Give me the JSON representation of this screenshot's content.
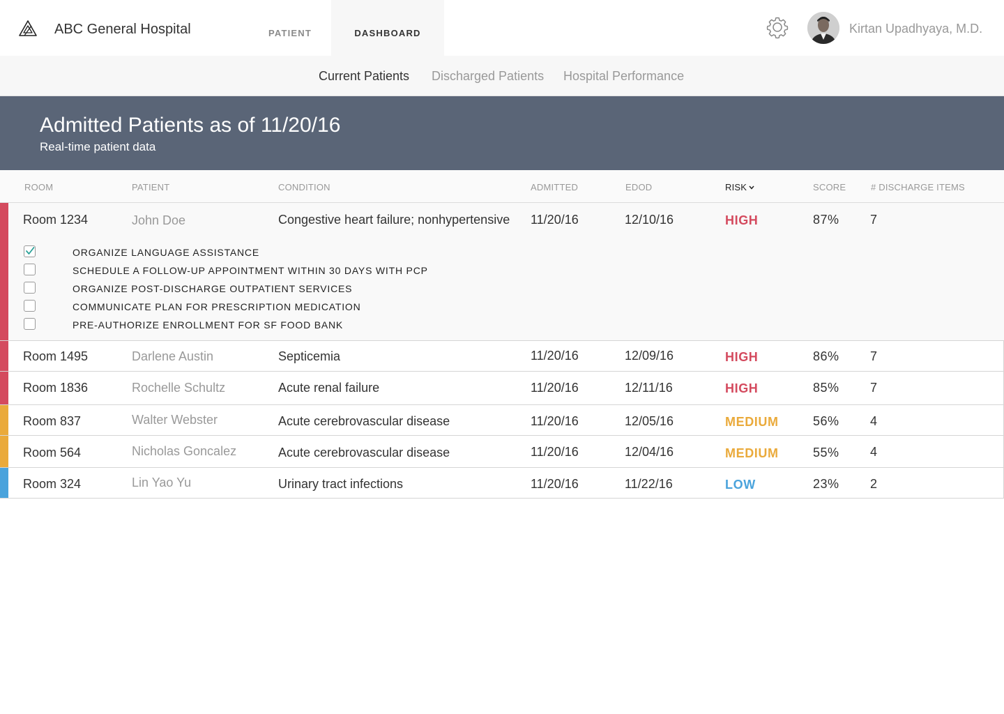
{
  "header": {
    "app_title": "ABC General Hospital",
    "logo_icon": "triangle-logo-icon",
    "tabs": [
      {
        "label": "PATIENT",
        "active": false
      },
      {
        "label": "DASHBOARD",
        "active": true
      }
    ],
    "settings_icon": "gear-icon",
    "user_name": "Kirtan Upadhyaya, M.D."
  },
  "subnav": {
    "tabs": [
      {
        "label": "Current Patients",
        "active": true
      },
      {
        "label": "Discharged Patients",
        "active": false
      },
      {
        "label": "Hospital Performance",
        "active": false
      }
    ]
  },
  "banner": {
    "title": "Admitted Patients as of 11/20/16",
    "subtitle": "Real-time patient data"
  },
  "table": {
    "columns": {
      "room": "ROOM",
      "patient": "PATIENT",
      "condition": "CONDITION",
      "admitted": "ADMITTED",
      "edod": "EDOD",
      "risk": "RISK",
      "score": "SCORE",
      "items": "# DISCHARGE ITEMS"
    },
    "sort_icon": "chevron-down-icon",
    "rows": [
      {
        "room": "Room 1234",
        "patient": "John Doe",
        "condition": "Congestive heart failure; nonhypertensive",
        "admitted": "11/20/16",
        "edod": "12/10/16",
        "risk": "HIGH",
        "score": "87%",
        "items": "7"
      },
      {
        "room": "Room 1495",
        "patient": "Darlene Austin",
        "condition": "Septicemia",
        "admitted": "11/20/16",
        "edod": "12/09/16",
        "risk": "HIGH",
        "score": "86%",
        "items": "7"
      },
      {
        "room": "Room 1836",
        "patient": "Rochelle Schultz",
        "condition": "Acute renal failure",
        "admitted": "11/20/16",
        "edod": "12/11/16",
        "risk": "HIGH",
        "score": "85%",
        "items": "7"
      },
      {
        "room": "Room 837",
        "patient": "Walter Webster",
        "condition": "Acute cerebrovascular disease",
        "admitted": "11/20/16",
        "edod": "12/05/16",
        "risk": "MEDIUM",
        "score": "56%",
        "items": "4"
      },
      {
        "room": "Room 564",
        "patient": "Nicholas Goncalez",
        "condition": "Acute cerebrovascular disease",
        "admitted": "11/20/16",
        "edod": "12/04/16",
        "risk": "MEDIUM",
        "score": "55%",
        "items": "4"
      },
      {
        "room": "Room 324",
        "patient": "Lin Yao Yu",
        "condition": "Urinary tract infections",
        "admitted": "11/20/16",
        "edod": "11/22/16",
        "risk": "LOW",
        "score": "23%",
        "items": "2"
      }
    ],
    "checklist": [
      {
        "label": "ORGANIZE LANGUAGE ASSISTANCE",
        "checked": true
      },
      {
        "label": "SCHEDULE A FOLLOW-UP APPOINTMENT WITHIN 30 DAYS WITH PCP",
        "checked": false
      },
      {
        "label": "ORGANIZE POST-DISCHARGE OUTPATIENT SERVICES",
        "checked": false
      },
      {
        "label": "COMMUNICATE PLAN FOR PRESCRIPTION MEDICATION",
        "checked": false
      },
      {
        "label": "PRE-AUTHORIZE ENROLLMENT FOR SF FOOD BANK",
        "checked": false
      }
    ]
  },
  "colors": {
    "high": "#d44a5e",
    "medium": "#eaaa3b",
    "low": "#4aa3dc",
    "banner": "#5a6577",
    "check_accent": "#2aa198"
  }
}
